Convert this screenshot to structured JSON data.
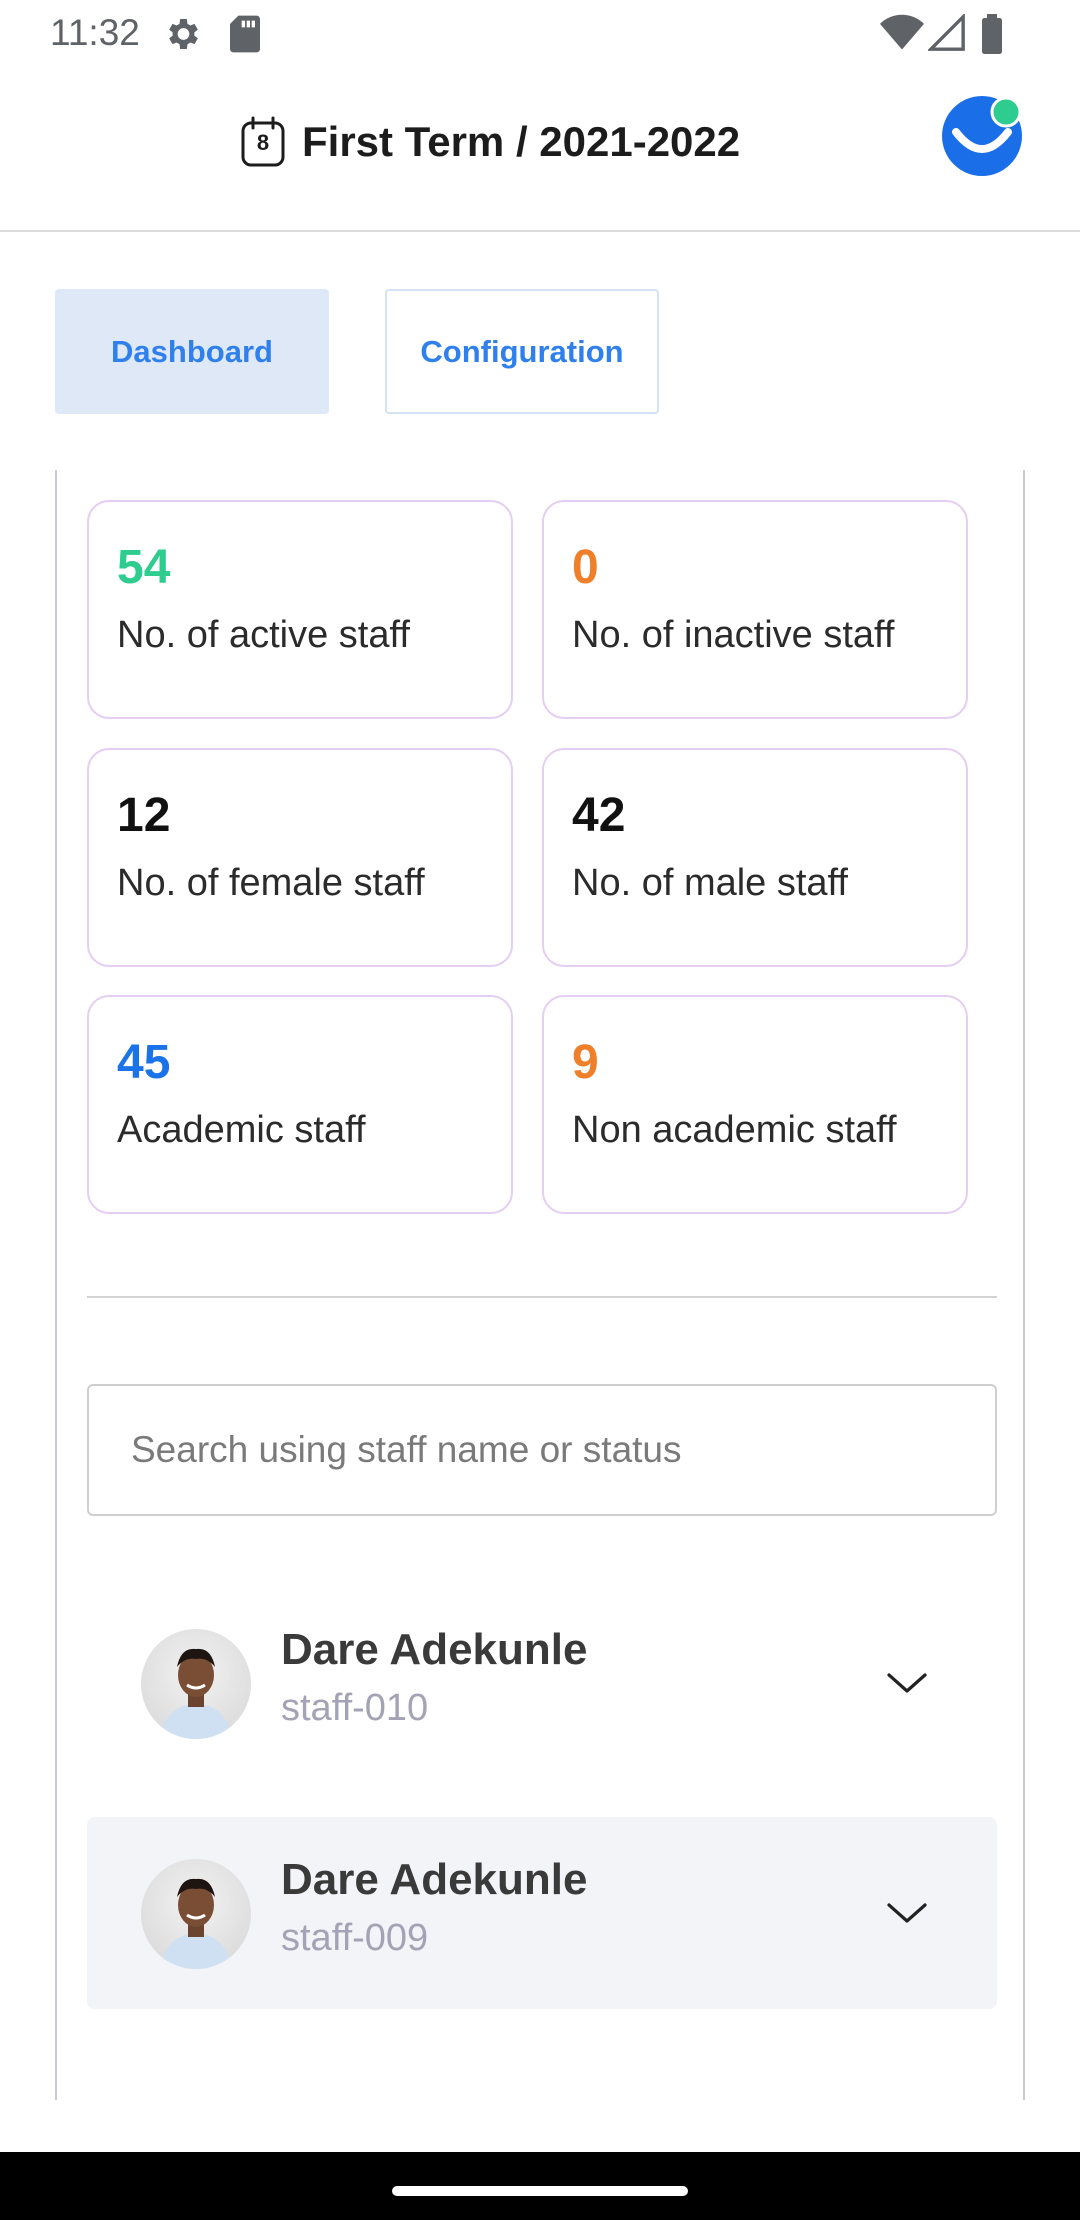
{
  "status_bar": {
    "time": "11:32"
  },
  "header": {
    "term_title": "First Term / 2021-2022",
    "calendar_day": "8"
  },
  "tabs": [
    {
      "label": "Dashboard",
      "active": true
    },
    {
      "label": "Configuration",
      "active": false
    }
  ],
  "stats": [
    {
      "value": "54",
      "label": "No. of active staff",
      "color": "#2ecc8f"
    },
    {
      "value": "0",
      "label": "No. of inactive staff",
      "color": "#f07f2a"
    },
    {
      "value": "12",
      "label": "No. of female staff",
      "color": "#111111"
    },
    {
      "value": "42",
      "label": "No. of male staff",
      "color": "#111111"
    },
    {
      "value": "45",
      "label": "Academic staff",
      "color": "#1a73e8"
    },
    {
      "value": "9",
      "label": "Non academic staff",
      "color": "#f07f2a"
    }
  ],
  "search": {
    "placeholder": "Search using staff name or status",
    "value": ""
  },
  "staff_list": [
    {
      "name": "Dare Adekunle",
      "id": "staff-010"
    },
    {
      "name": "Dare Adekunle",
      "id": "staff-009"
    }
  ],
  "colors": {
    "accent": "#2f80ed",
    "tab_active_bg": "#dfe8f6",
    "card_border": "#e6cdf2",
    "logo_blue": "#1a6fe8",
    "logo_dot": "#2ecc8f"
  }
}
